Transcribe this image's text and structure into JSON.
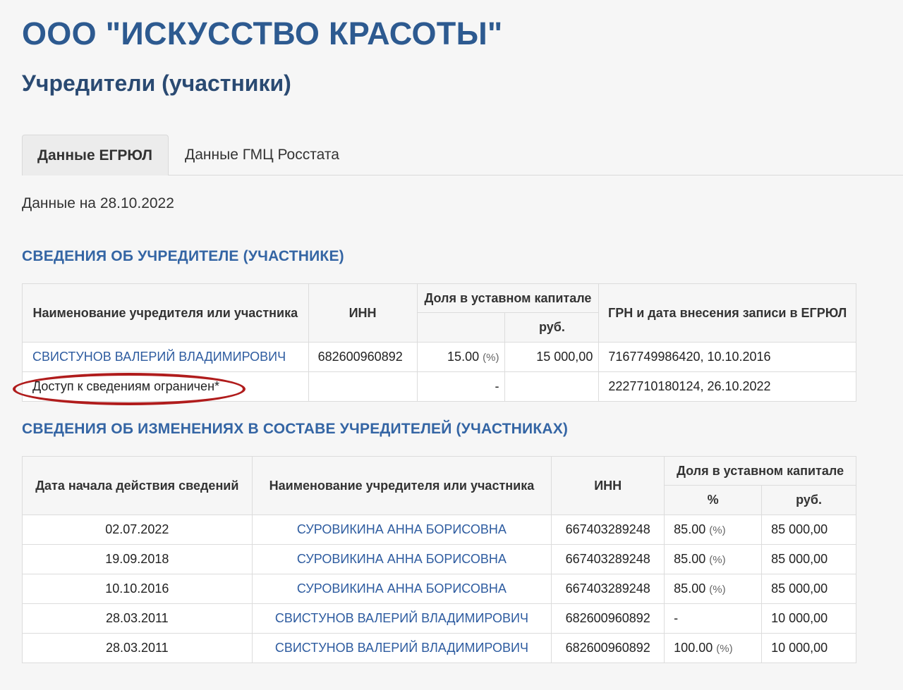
{
  "company": {
    "name": "ООО \"ИСКУССТВО КРАСОТЫ\""
  },
  "page": {
    "section_title": "Учредители (участники)"
  },
  "tabs": [
    {
      "label": "Данные ЕГРЮЛ",
      "active": true
    },
    {
      "label": "Данные ГМЦ Росстата",
      "active": false
    }
  ],
  "data_date": "Данные на 28.10.2022",
  "founders": {
    "title": "СВЕДЕНИЯ ОБ УЧРЕДИТЕЛЕ (УЧАСТНИКЕ)",
    "headers": {
      "name": "Наименование учредителя или участника",
      "inn": "ИНН",
      "share": "Доля в уставном капитале",
      "rub": "руб.",
      "grn": "ГРН и дата внесения записи в ЕГРЮЛ"
    },
    "rows": [
      {
        "name": "СВИСТУНОВ ВАЛЕРИЙ ВЛАДИМИРОВИЧ",
        "inn": "682600960892",
        "pct": "15.00",
        "pct_unit": "(%)",
        "rub": "15 000,00",
        "grn": "7167749986420, 10.10.2016"
      },
      {
        "name": "Доступ к сведениям ограничен*",
        "inn": "",
        "pct": "-",
        "pct_unit": "",
        "rub": "",
        "grn": "2227710180124, 26.10.2022"
      }
    ]
  },
  "changes": {
    "title": "СВЕДЕНИЯ ОБ ИЗМЕНЕНИЯХ В СОСТАВЕ УЧРЕДИТЕЛЕЙ (УЧАСТНИКАХ)",
    "headers": {
      "date": "Дата начала действия сведений",
      "name": "Наименование учредителя или участника",
      "inn": "ИНН",
      "share": "Доля в уставном капитале",
      "pct": "%",
      "rub": "руб."
    },
    "rows": [
      {
        "date": "02.07.2022",
        "name": "СУРОВИКИНА АННА БОРИСОВНА",
        "inn": "667403289248",
        "pct": "85.00",
        "pct_unit": "(%)",
        "rub": "85 000,00"
      },
      {
        "date": "19.09.2018",
        "name": "СУРОВИКИНА АННА БОРИСОВНА",
        "inn": "667403289248",
        "pct": "85.00",
        "pct_unit": "(%)",
        "rub": "85 000,00"
      },
      {
        "date": "10.10.2016",
        "name": "СУРОВИКИНА АННА БОРИСОВНА",
        "inn": "667403289248",
        "pct": "85.00",
        "pct_unit": "(%)",
        "rub": "85 000,00"
      },
      {
        "date": "28.03.2011",
        "name": "СВИСТУНОВ ВАЛЕРИЙ ВЛАДИМИРОВИЧ",
        "inn": "682600960892",
        "pct": "-",
        "pct_unit": "",
        "rub": "10 000,00"
      },
      {
        "date": "28.03.2011",
        "name": "СВИСТУНОВ ВАЛЕРИЙ ВЛАДИМИРОВИЧ",
        "inn": "682600960892",
        "pct": "100.00",
        "pct_unit": "(%)",
        "rub": "10 000,00"
      }
    ]
  },
  "colors": {
    "title": "#2d5a90",
    "link": "#2e5ca0",
    "highlight": "#b01c1c"
  }
}
